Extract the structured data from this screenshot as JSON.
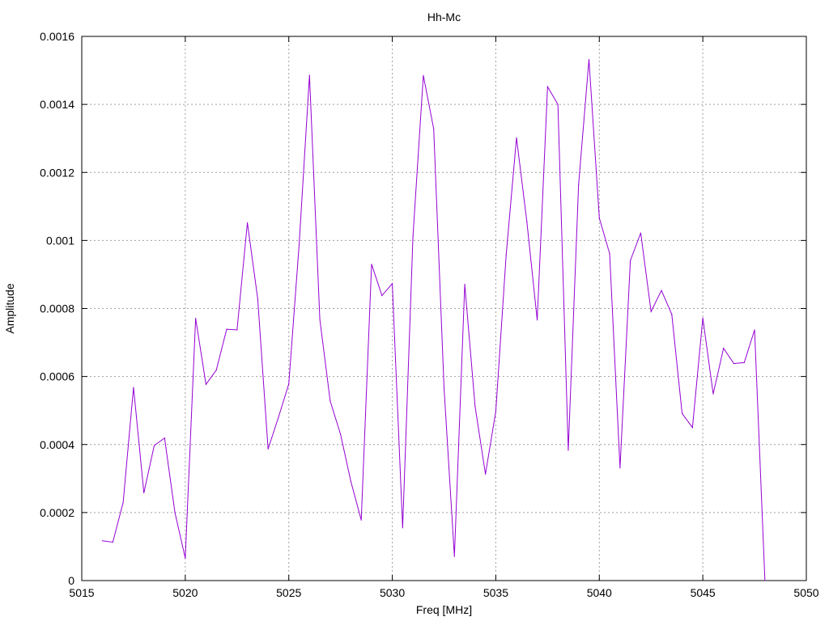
{
  "chart_data": {
    "type": "line",
    "title": "Hh-Mc",
    "xlabel": "Freq [MHz]",
    "ylabel": "Amplitude",
    "xlim": [
      5015,
      5050
    ],
    "ylim": [
      0,
      0.0016
    ],
    "grid": true,
    "x_ticks": [
      5015,
      5020,
      5025,
      5030,
      5035,
      5040,
      5045,
      5050
    ],
    "x_tick_labels": [
      "5015",
      "5020",
      "5025",
      "5030",
      "5035",
      "5040",
      "5045",
      "5050"
    ],
    "y_ticks": [
      0,
      0.0002,
      0.0004,
      0.0006,
      0.0008,
      0.001,
      0.0012,
      0.0014,
      0.0016
    ],
    "y_tick_labels": [
      "0",
      "0.0002",
      "0.0004",
      "0.0006",
      "0.0008",
      "0.001",
      "0.0012",
      "0.0014",
      "0.0016"
    ],
    "series": [
      {
        "color": "#9400d3",
        "x": [
          5016,
          5016.5,
          5017,
          5017.5,
          5018,
          5018.5,
          5019,
          5019.5,
          5020,
          5020.5,
          5021,
          5021.5,
          5022,
          5022.5,
          5023,
          5023.5,
          5024,
          5024.5,
          5025,
          5025.5,
          5026,
          5026.5,
          5027,
          5027.5,
          5028,
          5028.5,
          5029,
          5029.5,
          5030,
          5030.5,
          5031,
          5031.5,
          5032,
          5032.5,
          5033,
          5033.5,
          5034,
          5034.5,
          5035,
          5035.5,
          5036,
          5036.5,
          5037,
          5037.5,
          5038,
          5038.5,
          5039,
          5039.5,
          5040,
          5040.5,
          5041,
          5041.5,
          5042,
          5042.5,
          5043,
          5043.5,
          5044,
          5044.5,
          5045,
          5045.5,
          5046,
          5046.5,
          5047,
          5047.5,
          5048
        ],
        "y": [
          0.000117,
          0.000113,
          0.00023,
          0.000568,
          0.000258,
          0.000397,
          0.000419,
          0.0002,
          6.6e-05,
          0.000771,
          0.000577,
          0.000619,
          0.000739,
          0.000737,
          0.001052,
          0.000828,
          0.000387,
          0.00048,
          0.000578,
          0.000988,
          0.001486,
          0.000768,
          0.000528,
          0.00043,
          0.000291,
          0.000178,
          0.00093,
          0.000838,
          0.000873,
          0.000155,
          0.001014,
          0.001485,
          0.001328,
          0.000566,
          7.1e-05,
          0.000871,
          0.000512,
          0.000313,
          0.000498,
          0.000957,
          0.001302,
          0.001055,
          0.000766,
          0.001452,
          0.0014,
          0.000383,
          0.001165,
          0.001532,
          0.001066,
          0.000961,
          0.000331,
          0.000941,
          0.001022,
          0.000791,
          0.000853,
          0.000783,
          0.000491,
          0.00045,
          0.000772,
          0.000549,
          0.000683,
          0.000638,
          0.000641,
          0.000737,
          0.0
        ]
      }
    ]
  }
}
